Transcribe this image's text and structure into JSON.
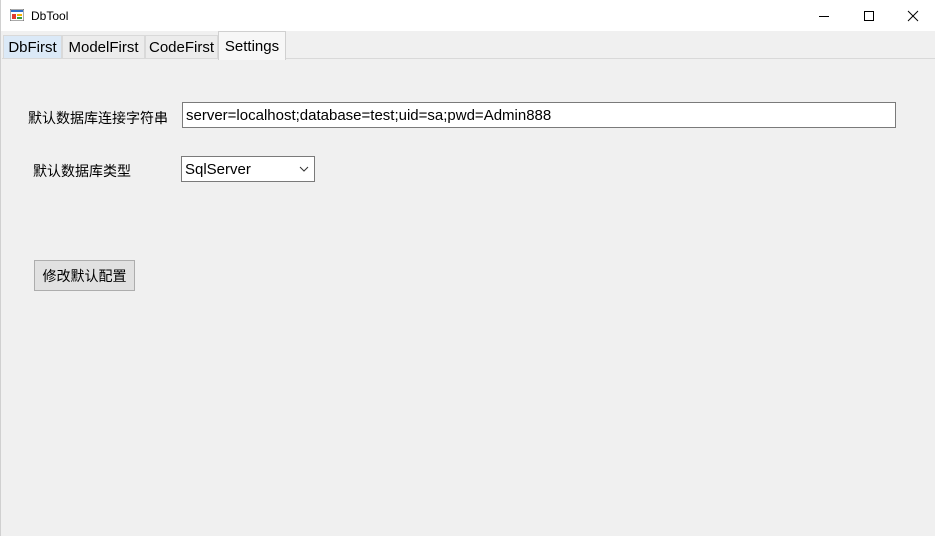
{
  "window": {
    "title": "DbTool",
    "app_icon": "dbtool-app-icon",
    "controls": {
      "minimize_icon": "minimize-icon",
      "maximize_icon": "maximize-icon",
      "close_icon": "close-icon"
    }
  },
  "tabs": [
    {
      "label": "DbFirst",
      "active": false
    },
    {
      "label": "ModelFirst",
      "active": false
    },
    {
      "label": "CodeFirst",
      "active": false
    },
    {
      "label": "Settings",
      "active": true
    }
  ],
  "settings": {
    "connection_label": "默认数据库连接字符串",
    "connection_value": "server=localhost;database=test;uid=sa;pwd=Admin888",
    "dbtype_label": "默认数据库类型",
    "dbtype_value": "SqlServer",
    "save_button": "修改默认配置"
  },
  "colors": {
    "titlebar_bg": "#ffffff",
    "window_bg": "#f0f0f0",
    "button_bg": "#e1e1e1",
    "first_tab_highlight": "#dbe9f7"
  }
}
